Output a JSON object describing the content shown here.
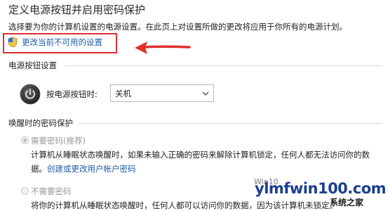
{
  "header": {
    "title": "定义电源按钮并启用密码保护",
    "subtitle": "选择要为你的计算机设置的电源设置。在此页上对设置所做的更改将应用于你所有的电源计划。"
  },
  "change_settings": {
    "label": "更改当前不可用的设置",
    "icon": "uac-shield-icon",
    "highlight_color": "#e03030"
  },
  "power_buttons": {
    "section_title": "电源按钮设置",
    "icon": "power-icon",
    "label": "按电源按钮时:",
    "selected_value": "关机"
  },
  "wake_password": {
    "section_title": "唤醒时的密码保护",
    "options": [
      {
        "label": "需要密码(推荐)",
        "selected": true,
        "enabled": false,
        "description_line1": "计算机从睡眠状态唤醒时，如果未输入正确的密码来解除计算机锁定，任何人都无法访问你的数",
        "description_line2_prefix": "据。",
        "description_link": "创建或更改用户帐户密码"
      },
      {
        "label": "不需要密码",
        "selected": false,
        "enabled": false,
        "description_line1": "将你的计算机从睡眠状态唤醒时，任何人都可以访问你的数据，因为该计算机未锁定。"
      }
    ]
  },
  "watermark": {
    "brand": "ylmfwin100.com",
    "site_text": "Win10",
    "chinese": "系统之家"
  },
  "colors": {
    "link": "#1f5ea8",
    "annotation_red": "#e03030"
  }
}
